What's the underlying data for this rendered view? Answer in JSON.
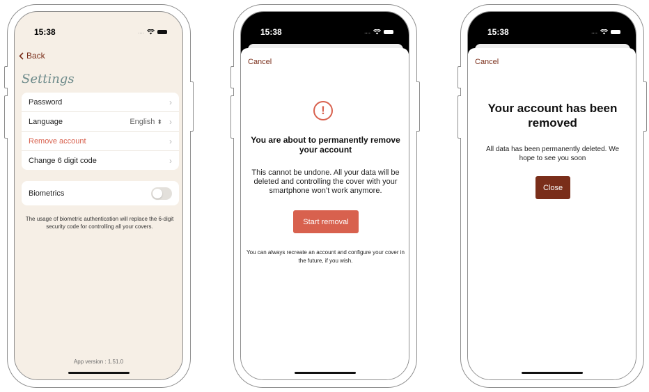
{
  "status_time": "15:38",
  "screens": {
    "settings": {
      "back_label": "Back",
      "title": "Settings",
      "items": {
        "password": "Password",
        "language": "Language",
        "language_value": "English",
        "remove_account": "Remove account",
        "change_code": "Change 6 digit code"
      },
      "biometrics_label": "Biometrics",
      "biometrics_enabled": false,
      "biometrics_note": "The usage of biometric authentication will replace the 6-digit security code for controlling all your covers.",
      "app_version": "App version : 1.51.0"
    },
    "confirm_removal": {
      "cancel_label": "Cancel",
      "icon_glyph": "!",
      "heading": "You are about to permanently remove your account",
      "body": "This cannot be undone. All your data will be deleted and controlling the cover with your smartphone won’t work anymore.",
      "button_label": "Start removal",
      "footnote": "You can always recreate an account and configure your cover in the future, if you wish."
    },
    "removed": {
      "cancel_label": "Cancel",
      "heading": "Your account has been removed",
      "body": "All data has been permanently deleted. We hope to see you soon",
      "button_label": "Close"
    }
  },
  "colors": {
    "accent_brown": "#7a2e1a",
    "danger": "#d8614e",
    "close_button": "#7a2e1a",
    "settings_bg": "#f6efe6",
    "title_teal": "#6e8b8b"
  },
  "icons": [
    "wifi-icon",
    "battery-icon",
    "chevron-left-icon",
    "chevron-right-icon",
    "updown-chevron-icon",
    "alert-circle-icon"
  ]
}
